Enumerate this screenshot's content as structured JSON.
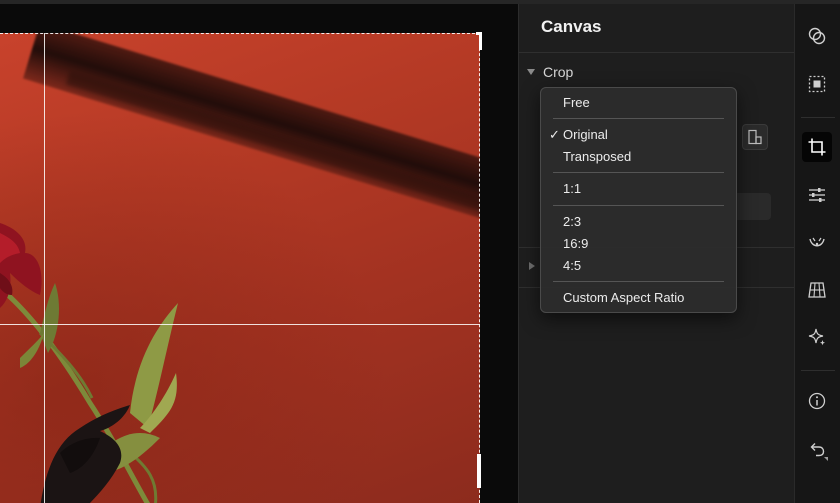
{
  "panel": {
    "title": "Canvas",
    "crop_label": "Crop"
  },
  "crop_menu": {
    "items": [
      {
        "label": "Free",
        "checked": false
      },
      {
        "label": "Original",
        "checked": true
      },
      {
        "label": "Transposed",
        "checked": false
      },
      {
        "label": "1:1",
        "checked": false
      },
      {
        "label": "2:3",
        "checked": false
      },
      {
        "label": "16:9",
        "checked": false
      },
      {
        "label": "4:5",
        "checked": false
      },
      {
        "label": "Custom Aspect Ratio",
        "checked": false
      }
    ],
    "check_glyph": "✓"
  },
  "toolbar": {
    "tools": [
      {
        "name": "blend-icon"
      },
      {
        "name": "selection-icon"
      },
      {
        "name": "crop-icon",
        "active": true
      },
      {
        "name": "adjustments-icon"
      },
      {
        "name": "retouch-icon"
      },
      {
        "name": "perspective-grid-icon"
      },
      {
        "name": "sparkle-icon"
      },
      {
        "name": "info-icon"
      },
      {
        "name": "undo-icon"
      }
    ]
  },
  "colors": {
    "accent_photo": "#b53a25",
    "panel_bg": "#1e1e1e",
    "menu_bg": "#2c2c2c"
  }
}
